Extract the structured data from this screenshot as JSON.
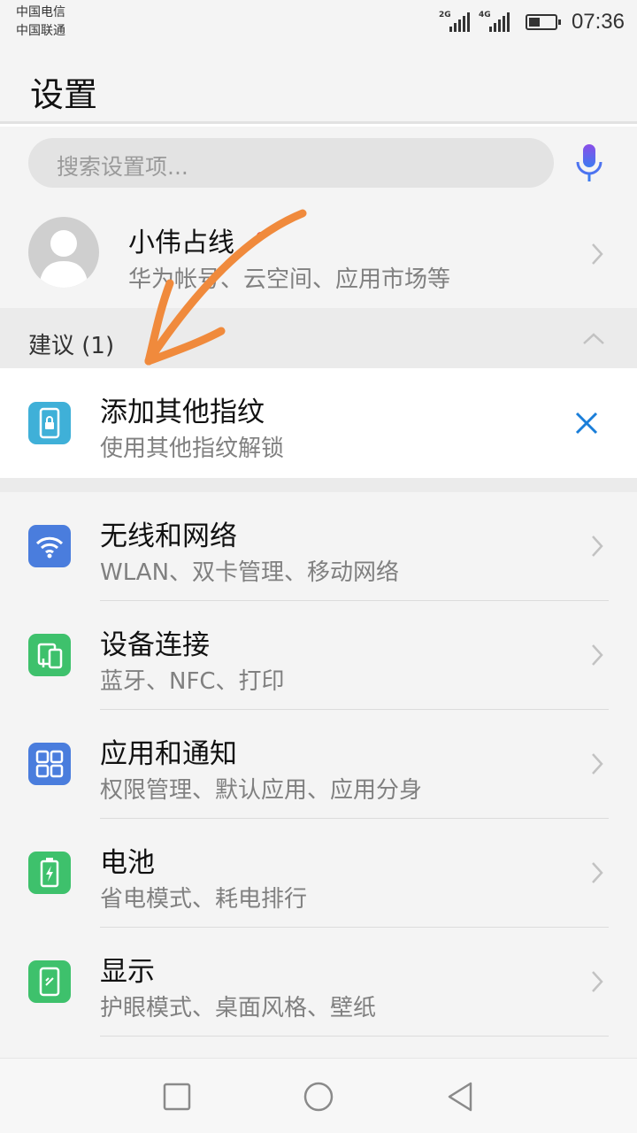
{
  "status": {
    "carrier_1": "中国电信",
    "carrier_2": "中国联通",
    "net_1": "2G",
    "net_2": "4G",
    "time": "07:36"
  },
  "page": {
    "title": "设置"
  },
  "search": {
    "placeholder": "搜索设置项..."
  },
  "account": {
    "name": "小伟占线",
    "subtitle": "华为帐号、云空间、应用市场等"
  },
  "suggestions": {
    "header": "建议 (1)",
    "item": {
      "title": "添加其他指纹",
      "subtitle": "使用其他指纹解锁",
      "icon": "fingerprint-phone-icon",
      "color": "#3fb0d8"
    }
  },
  "settings": [
    {
      "title": "无线和网络",
      "subtitle": "WLAN、双卡管理、移动网络",
      "icon": "wifi-icon",
      "color": "#4a7ddd"
    },
    {
      "title": "设备连接",
      "subtitle": "蓝牙、NFC、打印",
      "icon": "device-connection-icon",
      "color": "#3ec16c"
    },
    {
      "title": "应用和通知",
      "subtitle": "权限管理、默认应用、应用分身",
      "icon": "apps-icon",
      "color": "#4a7ddd"
    },
    {
      "title": "电池",
      "subtitle": "省电模式、耗电排行",
      "icon": "battery-icon",
      "color": "#3ec16c"
    },
    {
      "title": "显示",
      "subtitle": "护眼模式、桌面风格、壁纸",
      "icon": "display-icon",
      "color": "#3ec16c"
    }
  ],
  "colors": {
    "accent_blue": "#1a7ed9",
    "annotation_orange": "#f08a3c"
  }
}
